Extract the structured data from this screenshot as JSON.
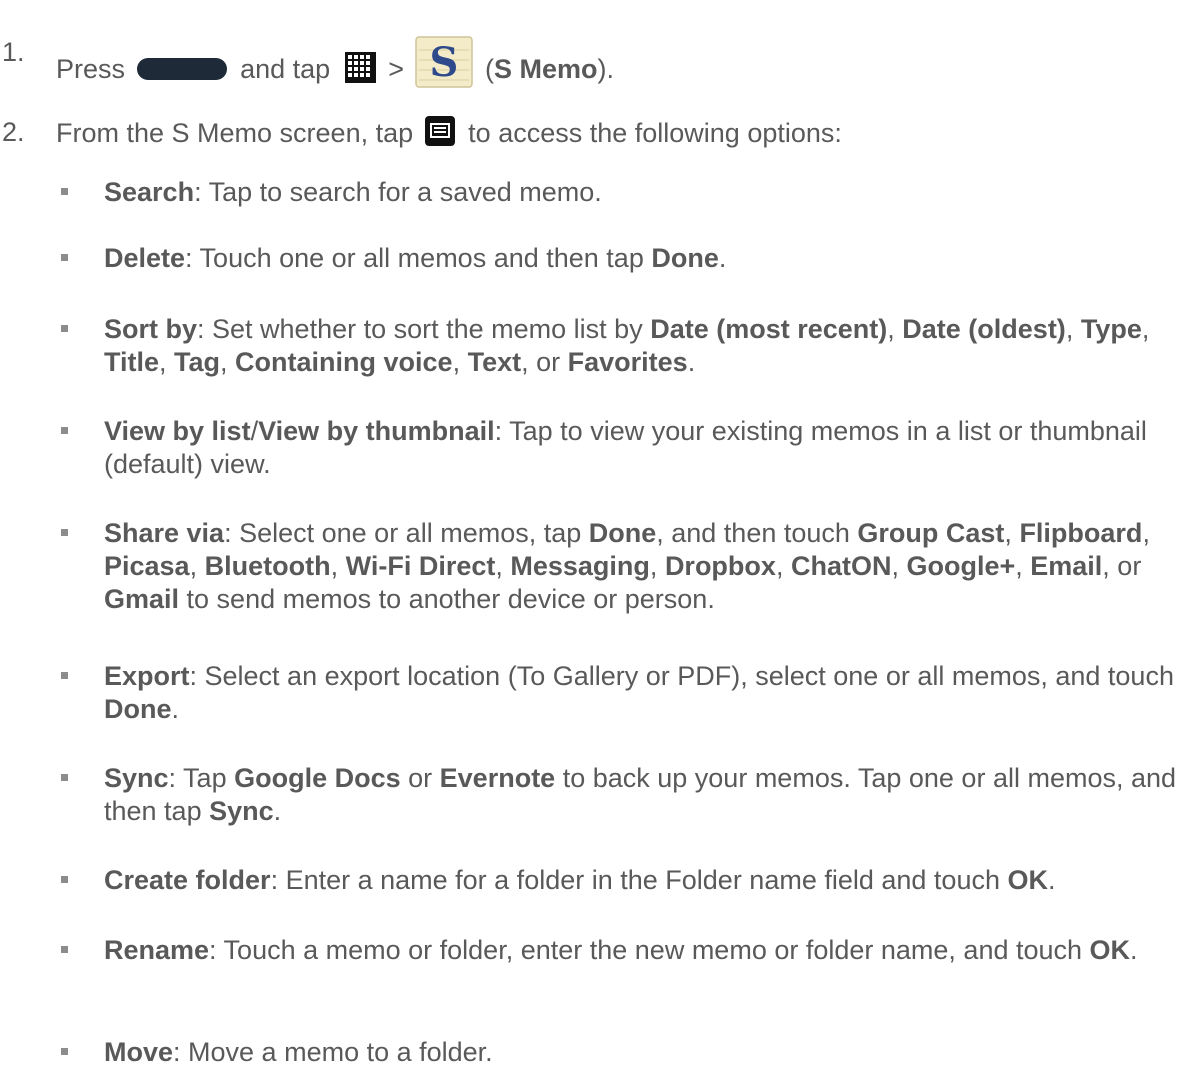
{
  "step1": {
    "number": "1.",
    "press": "Press",
    "and_tap": "and tap",
    "gt": ">",
    "app_name": "S Memo",
    "open_paren": "(",
    "close_paren": ")."
  },
  "step2": {
    "number": "2.",
    "text_before": "From the S Memo screen, tap",
    "text_after": "to access the following options:"
  },
  "bullets": {
    "search": {
      "term": "Search",
      "text": ": Tap to search for a saved memo."
    },
    "delete": {
      "term": "Delete",
      "text": ": Touch one or all memos and then tap ",
      "done": "Done",
      "end": "."
    },
    "sortby": {
      "term": "Sort by",
      "text": ": Set whether to sort the memo list by ",
      "opt1": "Date (most recent)",
      "opt2": "Date (oldest)",
      "opt3": "Type",
      "opt4": "Title",
      "opt5": "Tag",
      "opt6": "Containing voice",
      "opt7": "Text",
      "opt8": "Favorites"
    },
    "viewby": {
      "term1": "View by list",
      "slash": "/",
      "term2": "View by thumbnail",
      "text": ": Tap to view your existing memos in a list or thumbnail (default) view."
    },
    "share": {
      "term": "Share via",
      "text1": ": Select one or all memos, tap ",
      "done": "Done",
      "text2": ", and then touch ",
      "t1": "Group Cast",
      "t2": "Flipboard",
      "t3": "Picasa",
      "t4": "Bluetooth",
      "t5": "Wi-Fi Direct",
      "t6": "Messaging",
      "t7": "Dropbox",
      "t8": "ChatON",
      "t9": "Google+",
      "t10": "Email",
      "t11": "Gmail",
      "tail": " to send memos to another device or person."
    },
    "export": {
      "term": "Export",
      "text": ": Select an export location (To Gallery or PDF), select one or all memos, and touch ",
      "done": "Done"
    },
    "sync": {
      "term": "Sync",
      "text1": ": Tap ",
      "t1": "Google Docs",
      "or": " or ",
      "t2": "Evernote",
      "text2": " to back up your memos. Tap one or all memos, and then tap ",
      "t3": "Sync"
    },
    "createfolder": {
      "term": "Create folder",
      "text": ": Enter a name for a folder in the Folder name field and touch ",
      "ok": "OK"
    },
    "rename": {
      "term": "Rename",
      "text": ": Touch a memo or folder, enter the new memo or folder name, and touch ",
      "ok": "OK"
    },
    "move": {
      "term": "Move",
      "text": ": Move a memo to a folder."
    }
  },
  "icons": {
    "home_button": "home-button-icon",
    "apps_grid": "apps-grid-icon",
    "s_memo": "s-memo-icon",
    "menu": "menu-key-icon"
  },
  "colors": {
    "text": "#595959",
    "bullet": "#8c8c8c",
    "button": "#1f2a38"
  }
}
